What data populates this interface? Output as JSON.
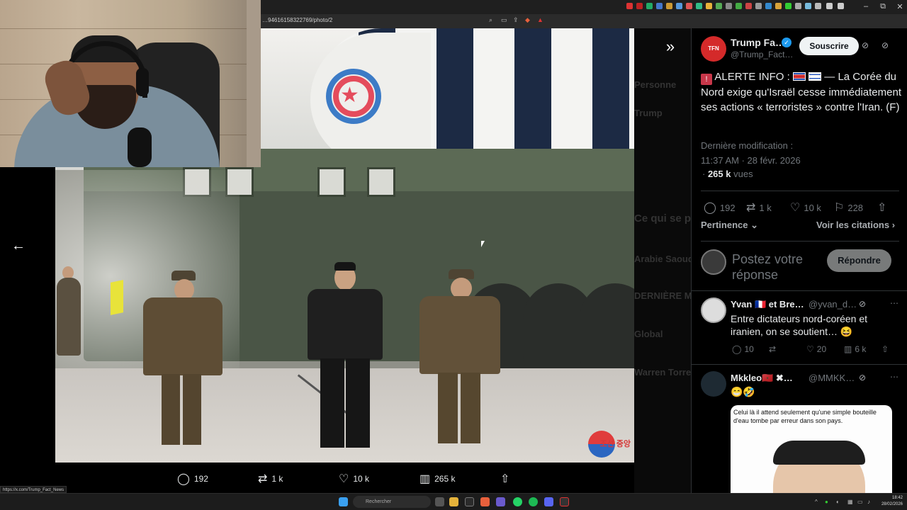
{
  "browser": {
    "url": "…94616158322769/photo/2",
    "status_url": "https://x.com/Trump_Fact_News",
    "window_buttons": [
      "–",
      "⧉",
      "✕"
    ]
  },
  "viewer": {
    "back_icon": "←",
    "collapse_icon": "»",
    "actions": {
      "replies": "192",
      "reposts": "1 k",
      "likes": "10 k",
      "views": "265 k"
    },
    "photo_watermark": "조선 중앙"
  },
  "background_feed": {
    "labels": [
      "Personne",
      "Trump",
      "Ce qui se p",
      "Arabie Saoud",
      "DERNIÈRE MI",
      "Global",
      "Warren Torres",
      "Yvan 🇫🇷 et Bre"
    ]
  },
  "tweet": {
    "avatar_label": "TFN",
    "author_name": "Trump Fa…",
    "author_handle": "@Trump_Fact…",
    "subscribe_label": "Souscrire",
    "text_prefix": "ALERTE INFO :",
    "text_body": "— La Corée du Nord exige qu'Israël cesse immédiatement ses actions « terroristes » contre l'Iran. (F)",
    "modified_label": "Dernière modification :",
    "datetime": "11:37 AM · 28 févr. 2026",
    "views_count": "265 k",
    "views_label": "vues",
    "stats": {
      "replies": "192",
      "reposts": "1 k",
      "likes": "10 k",
      "bookmarks": "228"
    },
    "sort_label": "Pertinence",
    "citations_label": "Voir les citations",
    "reply_placeholder": "Postez votre réponse",
    "reply_button": "Répondre"
  },
  "comments": [
    {
      "name": "Yvan 🇫🇷 et Bre…",
      "handle": "@yvan_d…",
      "text": "Entre dictateurs nord-coréen et iranien, on se soutient… 😆",
      "replies": "10",
      "likes": "20",
      "views": "6 k"
    },
    {
      "name": "Mkkleo🇲🇦 ✖…",
      "handle": "@MMKK…",
      "text": "😁🤣",
      "image_caption": "Celui là il attend seulement qu'une simple bouteille d'eau tombe par erreur dans son pays."
    }
  ],
  "taskbar": {
    "search_placeholder": "Rechercher",
    "time": "18:42",
    "date": "28/02/2026"
  },
  "colors": {
    "accent": "#1d9bf0",
    "alert_red": "#c8374a"
  }
}
